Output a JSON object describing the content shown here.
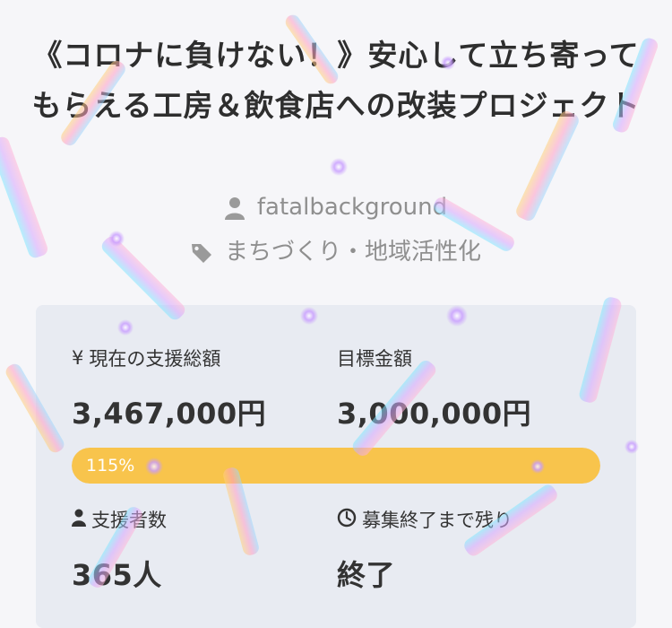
{
  "project": {
    "title": "《コロナに負けない！》安心して立ち寄ってもらえる工房＆飲食店への改装プロジェクト",
    "owner": "fatalbackground",
    "category": "まちづくり・地域活性化"
  },
  "stats": {
    "raised_label": "現在の支援総額",
    "raised_icon": "¥",
    "raised_value": "3,467,000円",
    "goal_label": "目標金額",
    "goal_value": "3,000,000円",
    "progress_label": "115%",
    "progress_fraction": 1.0,
    "backers_label": "支援者数",
    "backers_value": "365人",
    "time_label": "募集終了まで残り",
    "time_value": "終了"
  },
  "colors": {
    "progress_fill": "#f8c44c",
    "progress_track": "#dfe2ea",
    "card_bg": "#e8ebf2",
    "muted_text": "#8f8f8f"
  },
  "icons": {
    "owner": "user-icon",
    "category": "tag-icon",
    "backers": "user-icon",
    "time": "clock-icon"
  }
}
